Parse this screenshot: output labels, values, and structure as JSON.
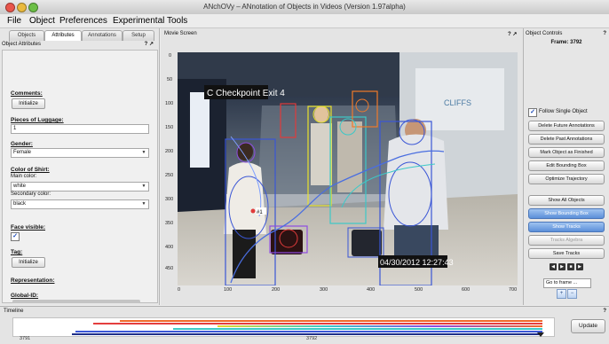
{
  "window": {
    "title": "ANchOVy – ANnotation of Objects in Videos (Version 1.97alpha)"
  },
  "menu": [
    "File",
    "Object",
    "Preferences",
    "Experimental Tools"
  ],
  "left_panel": {
    "tabs": [
      "Objects",
      "Attributes",
      "Annotations",
      "Setup"
    ],
    "active_tab": "Attributes",
    "title": "Object Attributes",
    "pin_icons": "? ↗",
    "comments": {
      "label": "Comments:",
      "button": "Initialize"
    },
    "luggage": {
      "label": "Pieces of Luggage:",
      "value": "1"
    },
    "gender": {
      "label": "Gender:",
      "value": "Female"
    },
    "shirt": {
      "label": "Color of Shirt:",
      "main_label": "Main color:",
      "main_value": "white",
      "secondary_label": "Secondary color:",
      "secondary_value": "black"
    },
    "face": {
      "label": "Face visible:",
      "checked": true
    },
    "tag": {
      "label": "Tag:",
      "button": "Initialize"
    },
    "representation": {
      "label": "Representation:"
    },
    "global_id": {
      "label": "Global-ID:"
    }
  },
  "movie": {
    "title": "Movie Screen",
    "pin_icons": "? ↗",
    "y_ticks": [
      "0",
      "50",
      "100",
      "150",
      "200",
      "250",
      "300",
      "350",
      "400",
      "450"
    ],
    "x_ticks": [
      "0",
      "100",
      "200",
      "300",
      "400",
      "500",
      "600",
      "700"
    ],
    "overlay_sign": "C Checkpoint Exit 4",
    "overlay_timestamp": "04/30/2012  12:27:43",
    "wall_sign": "CLIFFS",
    "person_label": "#1",
    "colors": {
      "blue": "#3a56d6",
      "yellow": "#e8e22c",
      "cyan": "#3cc9c8",
      "red": "#e03b3b",
      "orange": "#f07a2a",
      "purple": "#8f4ce0",
      "trajectory": "#4a6ee0"
    }
  },
  "controls": {
    "title": "Object Controls",
    "help": "?",
    "frame_label": "Frame: 3792",
    "follow_label": "Follow Single Object",
    "follow_checked": true,
    "buttons": [
      {
        "label": "Delete Future Annotations",
        "state": "normal"
      },
      {
        "label": "Delete Past Annotations",
        "state": "normal"
      },
      {
        "label": "Mark Object as Finished",
        "state": "normal"
      },
      {
        "label": "Edit Bounding Box",
        "state": "normal"
      },
      {
        "label": "Optimize Trajectory",
        "state": "normal"
      }
    ],
    "buttons2": [
      {
        "label": "Show All Objects",
        "state": "normal"
      },
      {
        "label": "Show Bounding Box",
        "state": "active"
      },
      {
        "label": "Show Tracks",
        "state": "active"
      },
      {
        "label": "Tracks Algebra",
        "state": "disabled"
      },
      {
        "label": "Save Tracks",
        "state": "normal"
      }
    ],
    "nav": [
      "◀",
      "▶",
      "■",
      "▶"
    ],
    "goto_placeholder": "Go to frame ...",
    "zoom_in": "+",
    "zoom_out": "−"
  },
  "timeline": {
    "title": "Timeline",
    "help": "?",
    "start_label": "3791",
    "current_label": "3792",
    "update_button": "Update"
  }
}
